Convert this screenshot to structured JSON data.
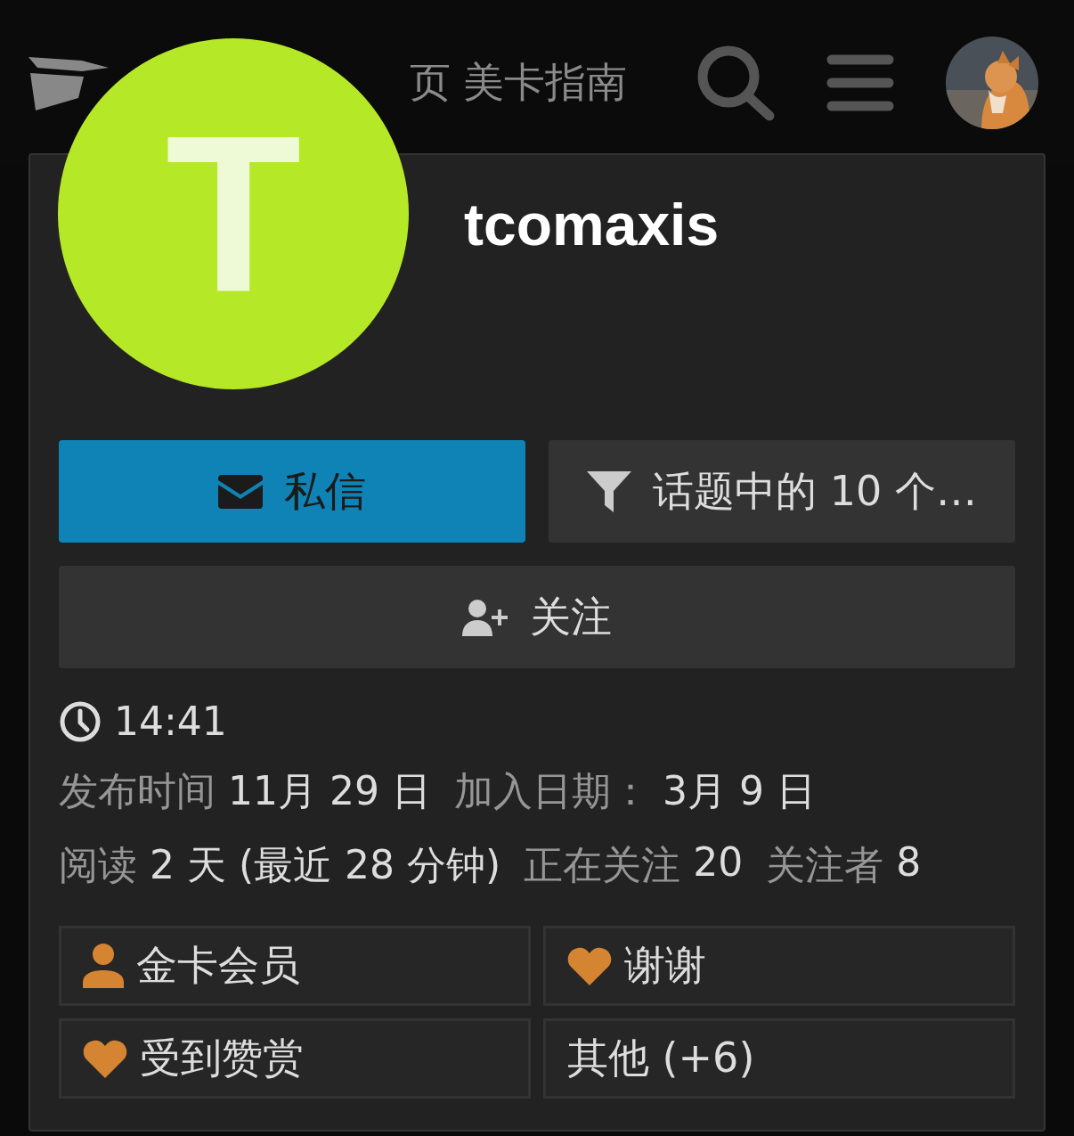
{
  "header": {
    "nav": [
      {
        "label": "页"
      },
      {
        "label": "美卡指南"
      }
    ]
  },
  "profile": {
    "avatar_letter": "T",
    "username": "tcomaxis"
  },
  "actions": [
    {
      "kind": "message",
      "label": "私信"
    },
    {
      "kind": "filter",
      "label": "话题中的 10 个…"
    },
    {
      "kind": "follow",
      "label": "关注"
    }
  ],
  "local_time": "14:41",
  "stats": [
    {
      "items": [
        {
          "label": "发布时间",
          "value": "11月 29 日"
        },
        {
          "label": "加入日期：",
          "value": "3月 9 日"
        }
      ]
    },
    {
      "items": [
        {
          "label": "阅读",
          "value": "2 天 (最近 28 分钟)"
        },
        {
          "label": "正在关注",
          "value": "20"
        },
        {
          "label": "关注者",
          "value": "8"
        }
      ]
    }
  ],
  "badges": [
    {
      "kind": "user",
      "label": "金卡会员"
    },
    {
      "kind": "heart",
      "label": "谢谢"
    },
    {
      "kind": "heart",
      "label": "受到赞赏"
    },
    {
      "kind": "more",
      "label": "其他 (+6)"
    }
  ]
}
